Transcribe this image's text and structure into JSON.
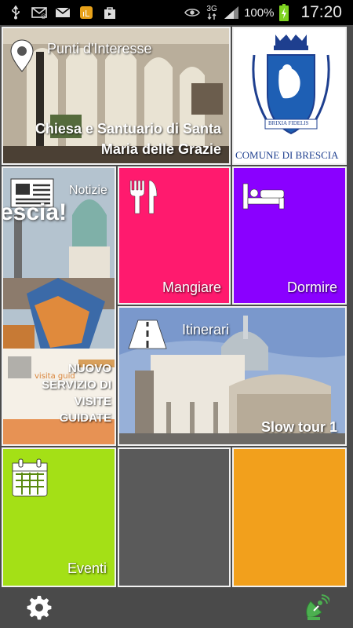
{
  "status_bar": {
    "network_type": "3G",
    "battery_percent": "100%",
    "time": "17:20"
  },
  "tiles": {
    "points_of_interest": {
      "title": "Punti d'Interesse",
      "caption_line1": "Chiesa e Santuario di Santa",
      "caption_line2": "Maria delle Grazie"
    },
    "comune": {
      "motto": "BRIXIA FIDELIS",
      "label": "COMUNE DI BRESCIA"
    },
    "news": {
      "title": "Notizie",
      "banner_text": "escia!",
      "caption": "NUOVO SERVIZIO DI VISITE GUIDATE"
    },
    "eat": {
      "label": "Mangiare",
      "color": "#ff1a6e"
    },
    "sleep": {
      "label": "Dormire",
      "color": "#8a00ff"
    },
    "itineraries": {
      "title": "Itinerari",
      "caption": "Slow tour 1"
    },
    "events": {
      "label": "Eventi",
      "color": "#a4e016"
    },
    "empty_gray": {
      "color": "#5a5a5a"
    },
    "empty_orange": {
      "color": "#f2a01c"
    }
  },
  "bottom_bar": {
    "settings_icon": "gear-icon",
    "location_icon": "satellite-location-icon"
  }
}
